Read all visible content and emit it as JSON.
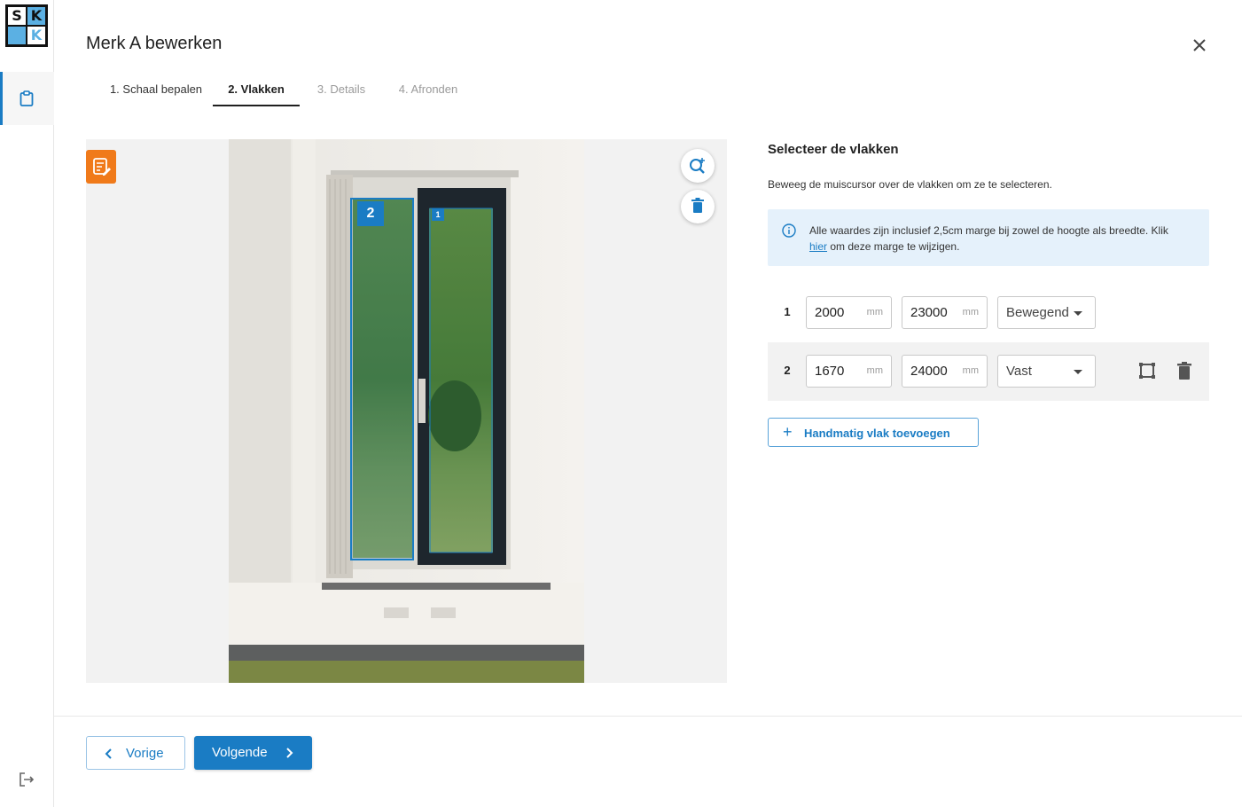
{
  "app": {
    "logo_letters": [
      "S",
      "K",
      "",
      "K"
    ],
    "accent_color": "#1a7cc4"
  },
  "header": {
    "title": "Merk A bewerken"
  },
  "tabs": [
    {
      "label": "1. Schaal bepalen",
      "state": "done"
    },
    {
      "label": "2. Vlakken",
      "state": "active"
    },
    {
      "label": "3. Details",
      "state": "inactive"
    },
    {
      "label": "4. Afronden",
      "state": "inactive"
    }
  ],
  "image_panel": {
    "pane_labels": [
      "2",
      "1"
    ]
  },
  "right_panel": {
    "title": "Selecteer de vlakken",
    "subtitle": "Beweeg de muiscursor over de vlakken om ze te selecteren.",
    "info_text_before": "Alle waardes zijn inclusief 2,5cm marge bij zowel de hoogte als breedte. Klik",
    "info_link": "hier",
    "info_text_after": "om deze marge te wijzigen."
  },
  "planes": [
    {
      "number": "1",
      "width": "2000",
      "height": "23000",
      "unit": "mm",
      "type": "Bewegend"
    },
    {
      "number": "2",
      "width": "1670",
      "height": "24000",
      "unit": "mm",
      "type": "Vast"
    }
  ],
  "actions": {
    "add_manual_label": "Handmatig vlak toevoegen"
  },
  "footer": {
    "prev_label": "Vorige",
    "next_label": "Volgende"
  }
}
